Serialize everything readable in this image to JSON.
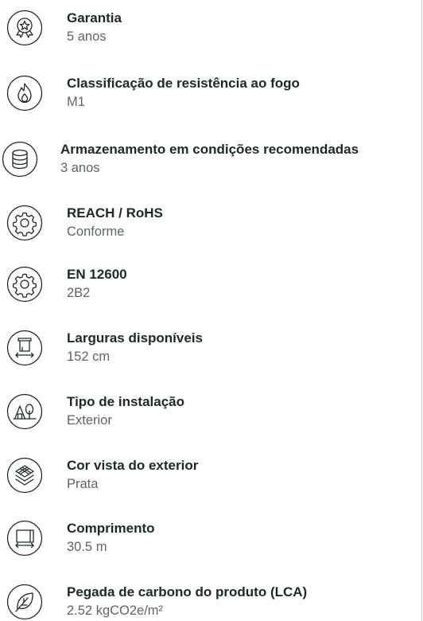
{
  "specs": [
    {
      "title": "Garantia",
      "value": "5 anos",
      "icon": "badge-star-icon"
    },
    {
      "title": "Classificação de resistência ao fogo",
      "value": "M1",
      "icon": "flame-icon"
    },
    {
      "title": "Armazenamento em condições recomendadas",
      "value": "3 anos",
      "icon": "database-icon"
    },
    {
      "title": "REACH / RoHS",
      "value": "Conforme",
      "icon": "gear-icon"
    },
    {
      "title": "EN 12600",
      "value": "2B2",
      "icon": "gear-icon"
    },
    {
      "title": "Larguras disponíveis",
      "value": "152 cm",
      "icon": "roll-width-icon"
    },
    {
      "title": "Tipo de instalação",
      "value": "Exterior",
      "icon": "house-tree-icon"
    },
    {
      "title": "Cor vista do exterior",
      "value": "Prata",
      "icon": "layers-icon"
    },
    {
      "title": "Comprimento",
      "value": "30.5 m",
      "icon": "length-icon"
    },
    {
      "title": "Pegada de carbono do produto (LCA)",
      "value": "2.52 kgCO2e/m²",
      "icon": "leaf-icon"
    }
  ],
  "colors": {
    "icon_stroke": "#1f2a24",
    "title": "#1d2a23",
    "value": "#5d6661",
    "divider": "#cfd6d2"
  }
}
